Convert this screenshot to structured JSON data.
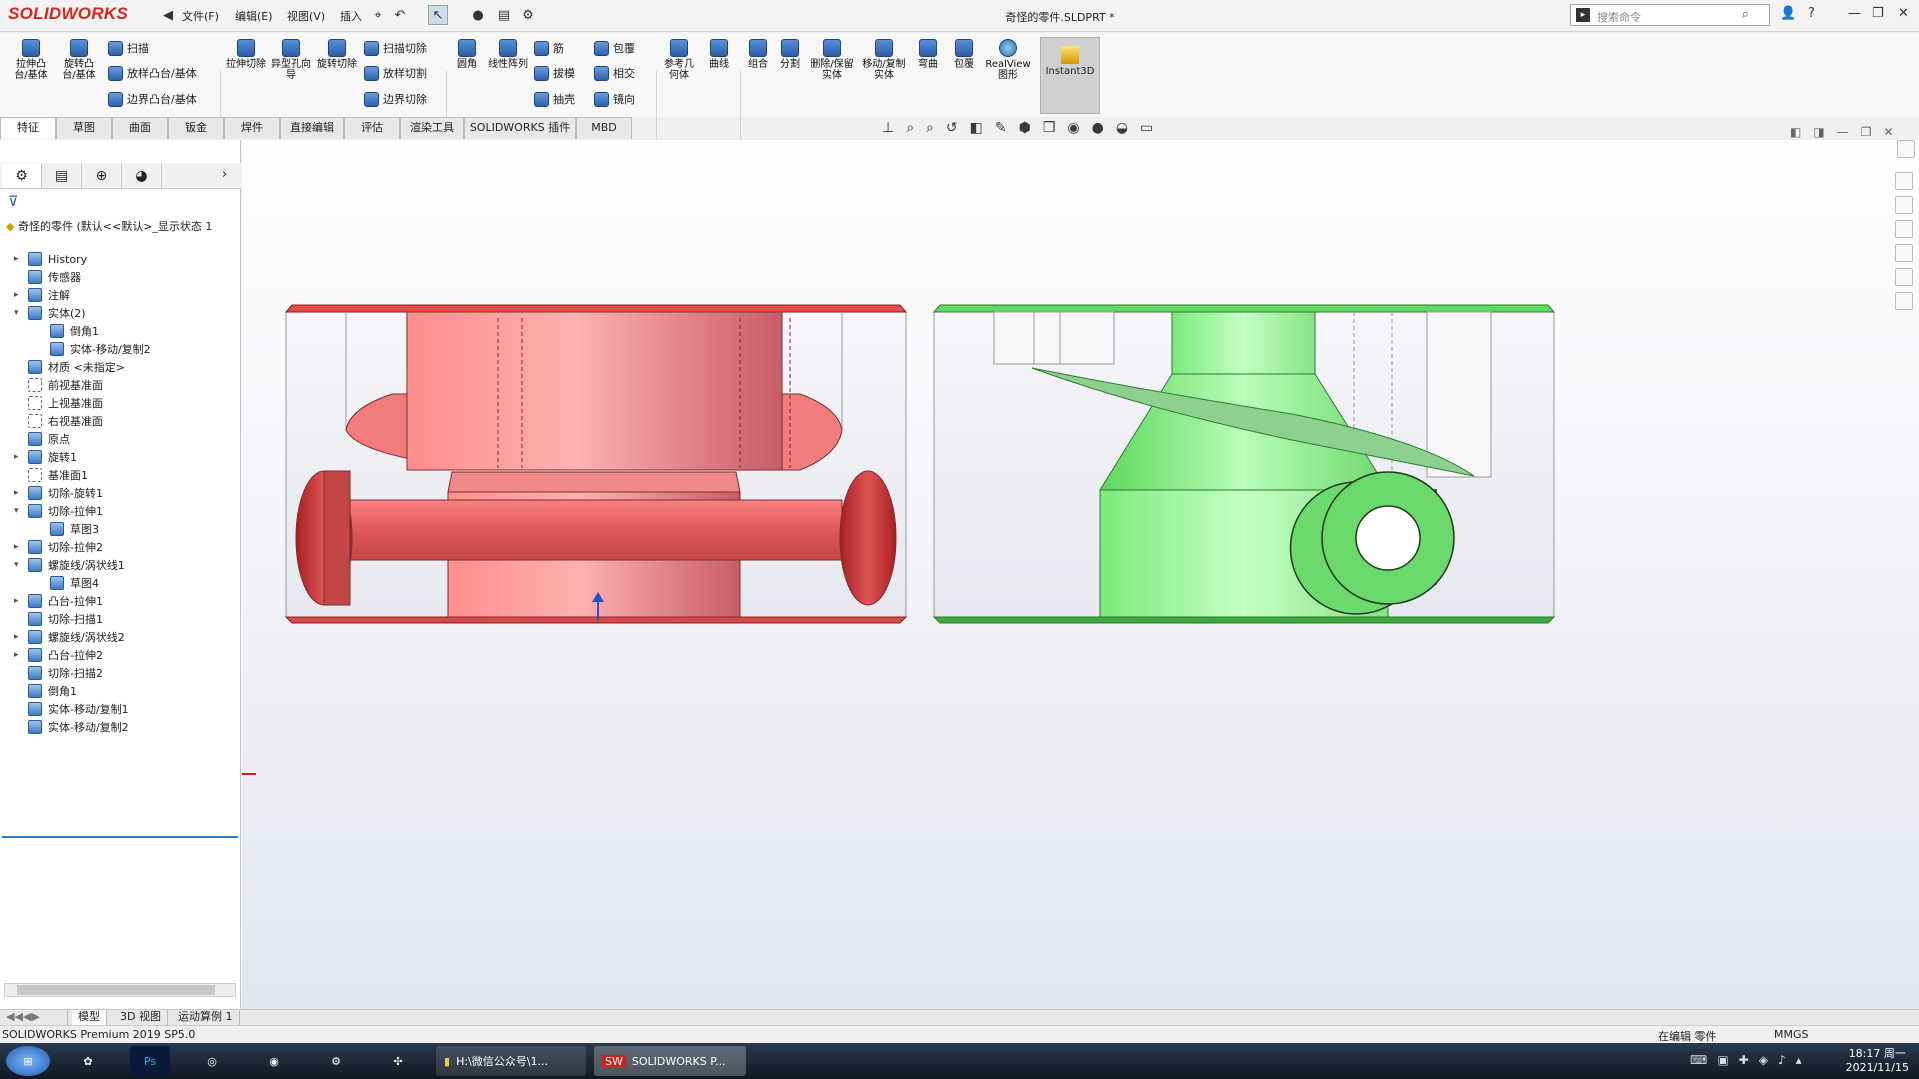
{
  "app": {
    "logo": "SOLIDWORKS",
    "document_title": "奇怪的零件.SLDPRT *"
  },
  "menu": {
    "file": "文件(F)",
    "edit": "编辑(E)",
    "view": "视图(V)",
    "insert": "插入"
  },
  "search": {
    "placeholder": "搜索命令"
  },
  "ribbon": {
    "extrude_boss": "拉伸凸台/基体",
    "revolve_boss": "旋转凸台/基体",
    "sweep": "扫描",
    "loft": "放样凸台/基体",
    "boundary": "边界凸台/基体",
    "extrude_cut": "拉伸切除",
    "hole_wizard": "异型孔向导",
    "revolve_cut": "旋转切除",
    "swept_cut": "扫描切除",
    "lofted_cut": "放样切割",
    "boundary_cut": "边界切除",
    "fillet": "圆角",
    "linear_pattern": "线性阵列",
    "rib": "筋",
    "draft": "拔模",
    "shell": "抽壳",
    "wrap": "包覆",
    "intersect": "相交",
    "mirror": "镜向",
    "ref_geom": "参考几何体",
    "curves": "曲线",
    "combine": "组合",
    "split": "分割",
    "delete_keep": "删除/保留实体",
    "move_copy": "移动/复制实体",
    "flex": "弯曲",
    "wrap2": "包覆",
    "realview": "RealView图形",
    "instant3d": "Instant3D"
  },
  "cm_tabs": [
    "特征",
    "草图",
    "曲面",
    "钣金",
    "焊件",
    "直接编辑",
    "评估",
    "渲染工具",
    "SOLIDWORKS 插件",
    "MBD"
  ],
  "tree": {
    "root": "奇怪的零件 (默认<<默认>_显示状态 1",
    "items": [
      "History",
      "传感器",
      "注解",
      "实体(2)",
      "倒角1",
      "实体-移动/复制2",
      "材质 <未指定>",
      "前视基准面",
      "上视基准面",
      "右视基准面",
      "原点",
      "旋转1",
      "基准面1",
      "切除-旋转1",
      "切除-拉伸1",
      "草图3",
      "切除-拉伸2",
      "螺旋线/涡状线1",
      "草图4",
      "凸台-拉伸1",
      "切除-扫描1",
      "螺旋线/涡状线2",
      "凸台-拉伸2",
      "切除-扫描2",
      "倒角1",
      "实体-移动/复制1",
      "实体-移动/复制2"
    ]
  },
  "bottom_tabs": {
    "model": "模型",
    "view3d": "3D 视图",
    "motion": "运动算例 1"
  },
  "status": {
    "product": "SOLIDWORKS Premium 2019 SP5.0",
    "editing": "在编辑 零件",
    "units": "MMGS"
  },
  "taskbar": {
    "folder": "H:\\微信公众号\\1...",
    "solidworks": "SOLIDWORKS P...",
    "time": "18:17 周一",
    "date": "2021/11/15"
  },
  "colors": {
    "red_body": "#e85a5a",
    "green_body": "#6fdc6f"
  }
}
